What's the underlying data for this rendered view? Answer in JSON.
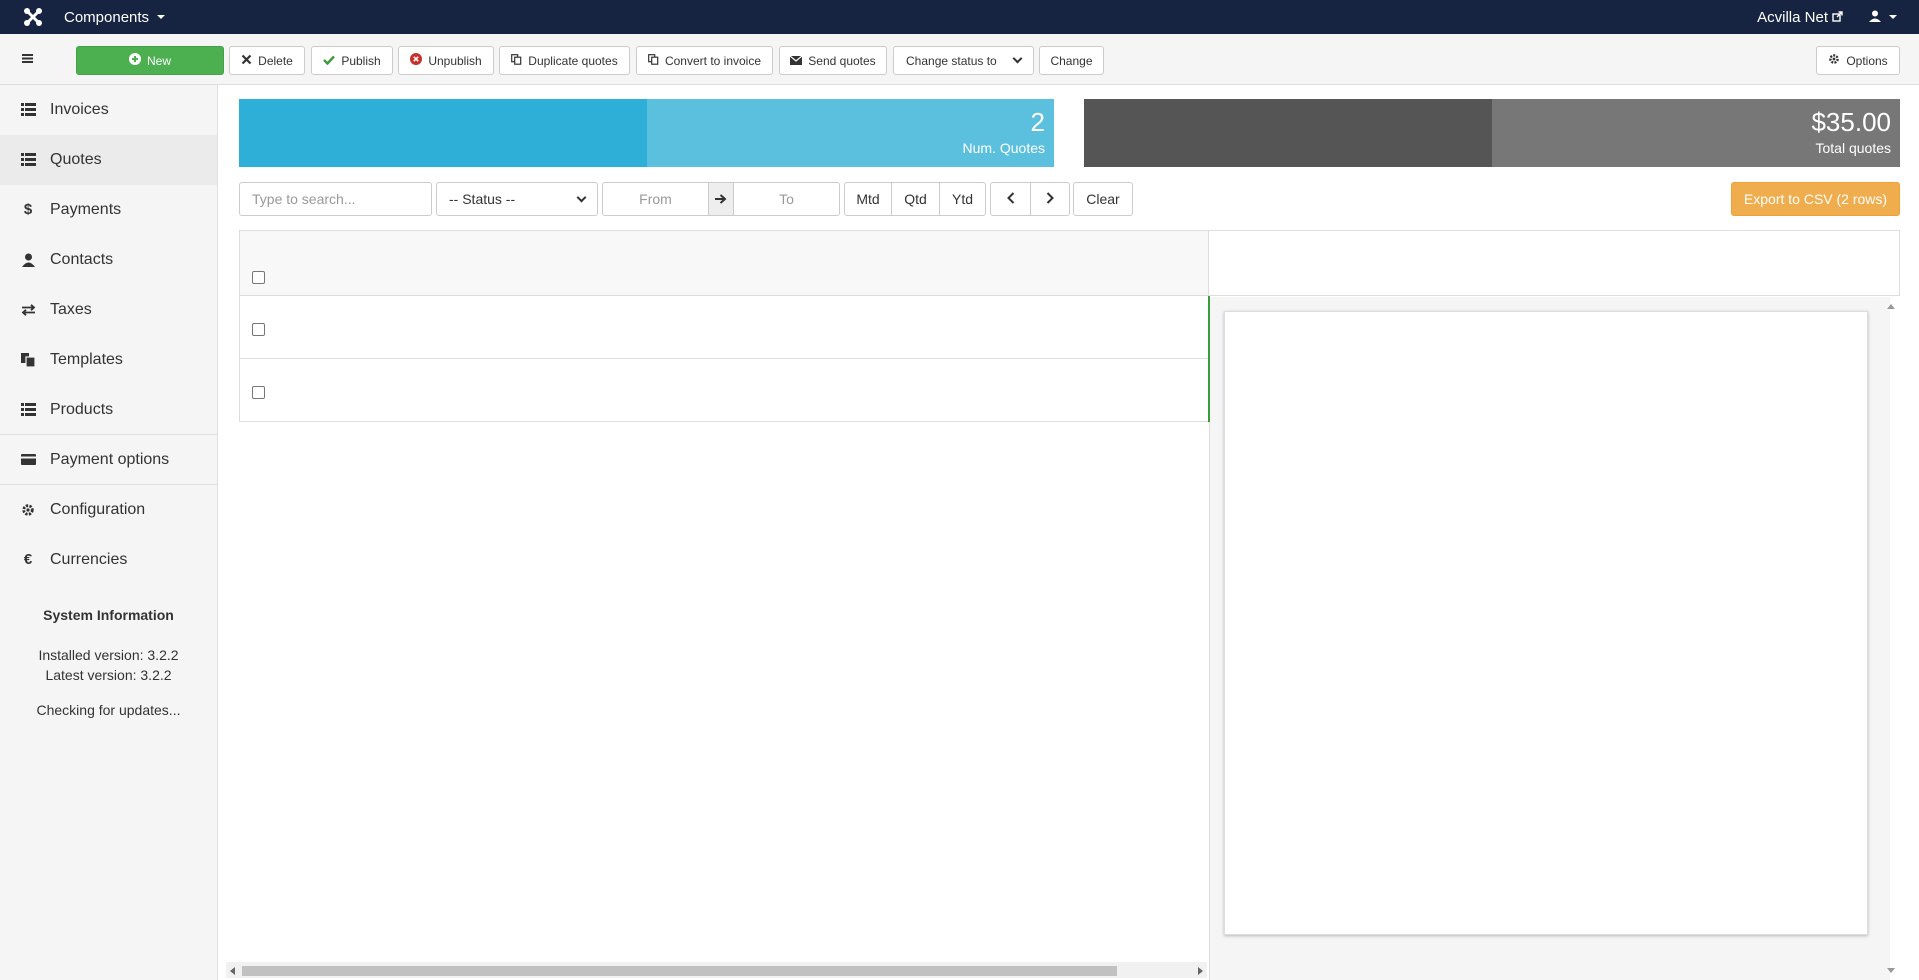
{
  "topbar": {
    "menu_label": "Components",
    "site_name": "Acvilla Net",
    "icons": [
      "joomla-logo-icon",
      "external-link-icon",
      "user-icon"
    ]
  },
  "toolbar": {
    "new_label": "New",
    "delete_label": "Delete",
    "publish_label": "Publish",
    "unpublish_label": "Unpublish",
    "duplicate_label": "Duplicate quotes",
    "convert_label": "Convert to invoice",
    "send_label": "Send quotes",
    "status_select": "Change status to",
    "change_label": "Change",
    "options_label": "Options"
  },
  "sidebar": {
    "items": [
      {
        "label": "Invoices",
        "icon": "list-icon"
      },
      {
        "label": "Quotes",
        "icon": "list-icon"
      },
      {
        "label": "Payments",
        "icon": "dollar-icon"
      },
      {
        "label": "Contacts",
        "icon": "user-icon"
      },
      {
        "label": "Taxes",
        "icon": "exchange-icon"
      },
      {
        "label": "Templates",
        "icon": "copy-icon"
      },
      {
        "label": "Products",
        "icon": "list-icon"
      },
      {
        "label": "Payment options",
        "icon": "credit-card-icon"
      },
      {
        "label": "Configuration",
        "icon": "gear-icon"
      },
      {
        "label": "Currencies",
        "icon": "euro-icon"
      }
    ],
    "active": "Quotes",
    "system_info": {
      "title": "System Information",
      "installed": "Installed version: 3.2.2",
      "latest": "Latest version: 3.2.2",
      "status": "Checking for updates..."
    }
  },
  "stats": {
    "quotes": {
      "value": "2",
      "label": "Num. Quotes"
    },
    "total": {
      "value": "$35.00",
      "label": "Total quotes"
    }
  },
  "filters": {
    "search_placeholder": "Type to search...",
    "status_select": "-- Status --",
    "from_placeholder": "From",
    "to_placeholder": "To",
    "mtd": "Mtd",
    "qtd": "Qtd",
    "ytd": "Ytd",
    "clear": "Clear",
    "export": "Export to CSV (2 rows)"
  },
  "colors": {
    "navbar": "#162341",
    "new_button": "#4caf50",
    "quotes_card_dark": "#2eafd8",
    "quotes_card_light": "#5bc0de",
    "total_card_dark": "#555555",
    "total_card_light": "#777777",
    "export_button": "#f0ad4e"
  }
}
